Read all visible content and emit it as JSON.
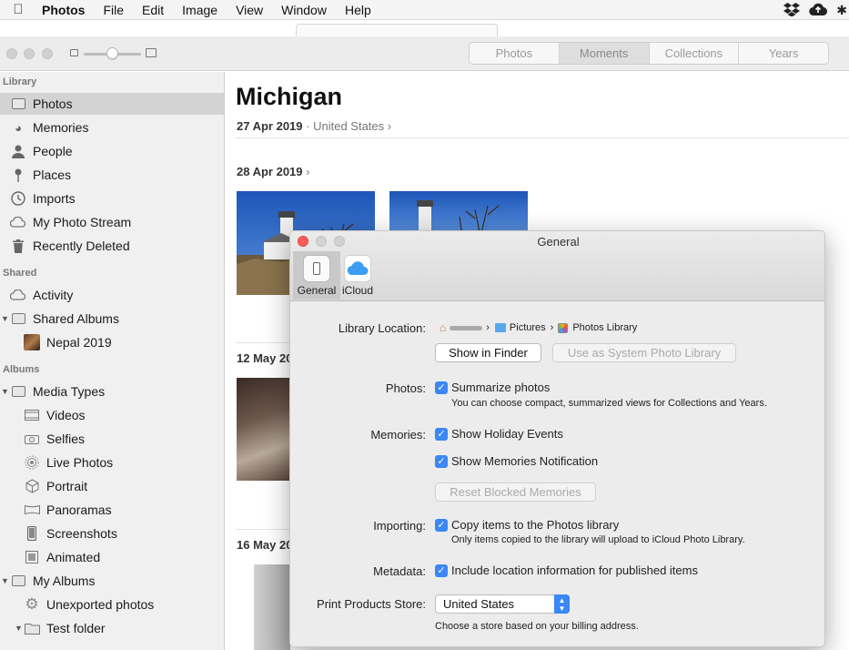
{
  "menubar": {
    "app": "Photos",
    "items": [
      "File",
      "Edit",
      "Image",
      "View",
      "Window",
      "Help"
    ]
  },
  "toolbar": {
    "segments": [
      "Photos",
      "Moments",
      "Collections",
      "Years"
    ],
    "active_segment": "Moments"
  },
  "sidebar": {
    "library_header": "Library",
    "library": [
      "Photos",
      "Memories",
      "People",
      "Places",
      "Imports",
      "My Photo Stream",
      "Recently Deleted"
    ],
    "shared_header": "Shared",
    "shared": [
      "Activity",
      "Shared Albums",
      "Nepal 2019"
    ],
    "albums_header": "Albums",
    "albums": [
      "Media Types",
      "Videos",
      "Selfies",
      "Live Photos",
      "Portrait",
      "Panoramas",
      "Screenshots",
      "Animated",
      "My Albums",
      "Unexported photos",
      "Test folder"
    ]
  },
  "main": {
    "title": "Michigan",
    "date_range": "27 Apr 2019",
    "location": "United States",
    "sections": [
      "28 Apr 2019",
      "12 May 20",
      "16 May 20"
    ]
  },
  "dialog": {
    "title": "General",
    "tabs": [
      "General",
      "iCloud"
    ],
    "library_location_label": "Library Location:",
    "path": [
      "Pictures",
      "Photos Library"
    ],
    "show_in_finder": "Show in Finder",
    "use_system_library": "Use as System Photo Library",
    "photos_label": "Photos:",
    "summarize": "Summarize photos",
    "summarize_note": "You can choose compact, summarized views for Collections and Years.",
    "memories_label": "Memories:",
    "holiday": "Show Holiday Events",
    "memories_notification": "Show Memories Notification",
    "reset_blocked": "Reset Blocked Memories",
    "importing_label": "Importing:",
    "copy_items": "Copy items to the Photos library",
    "copy_note": "Only items copied to the library will upload to iCloud Photo Library.",
    "metadata_label": "Metadata:",
    "include_location": "Include location information for published items",
    "print_store_label": "Print Products Store:",
    "print_store_value": "United States",
    "print_store_note": "Choose a store based on your billing address."
  },
  "colors": {
    "accent": "#3b87f5",
    "close": "#fc5f57",
    "sidebar_selected": "#d3d3d3"
  }
}
